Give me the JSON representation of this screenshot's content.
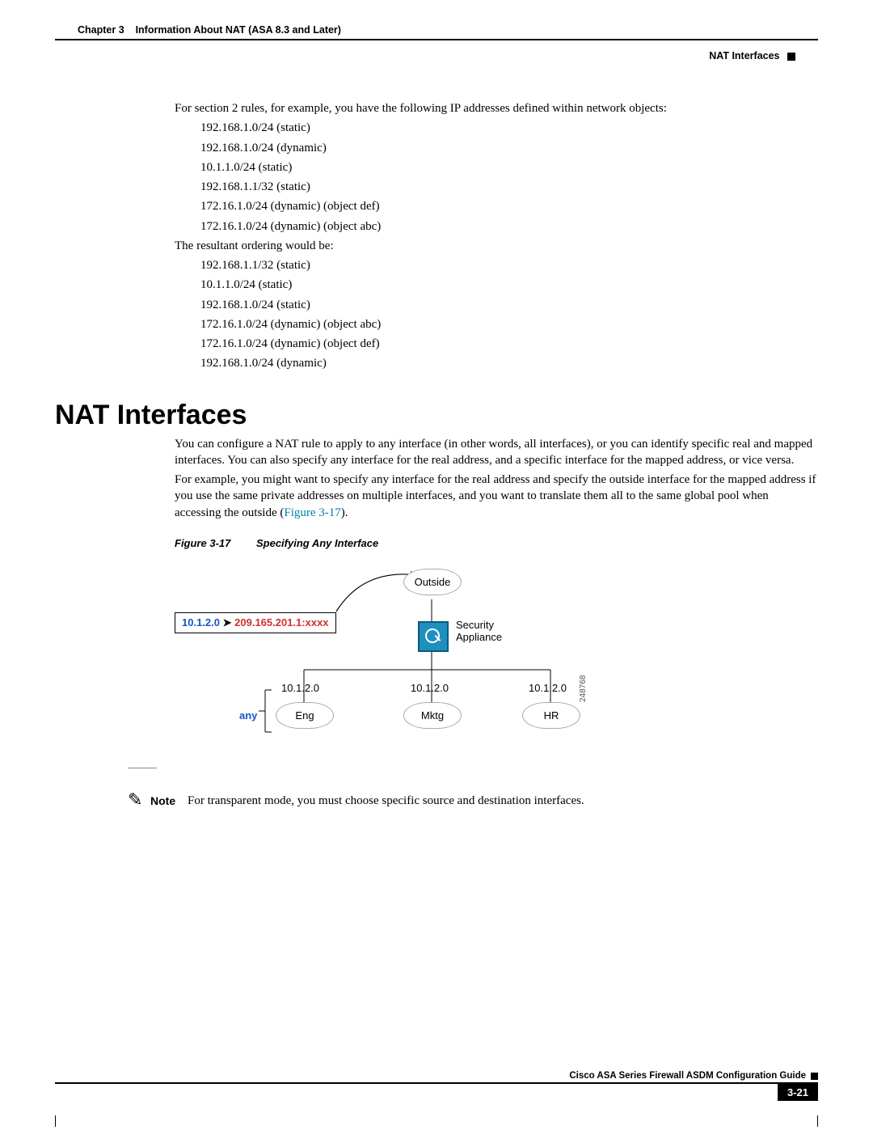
{
  "header": {
    "chapter": "Chapter 3",
    "chapter_title": "Information About NAT (ASA 8.3 and Later)",
    "section_right": "NAT Interfaces"
  },
  "body": {
    "p_intro": "For section 2 rules, for example, you have the following IP addresses defined within network objects:",
    "list1": [
      "192.168.1.0/24 (static)",
      "192.168.1.0/24 (dynamic)",
      "10.1.1.0/24 (static)",
      "192.168.1.1/32 (static)",
      "172.16.1.0/24 (dynamic) (object def)",
      "172.16.1.0/24 (dynamic) (object abc)"
    ],
    "p_result": "The resultant ordering would be:",
    "list2": [
      "192.168.1.1/32 (static)",
      "10.1.1.0/24 (static)",
      "192.168.1.0/24 (static)",
      "172.16.1.0/24 (dynamic) (object abc)",
      "172.16.1.0/24 (dynamic) (object def)",
      "192.168.1.0/24 (dynamic)"
    ],
    "h1": "NAT Interfaces",
    "p1": "You can configure a NAT rule to apply to any interface (in other words, all interfaces), or you can identify specific real and mapped interfaces. You can also specify any interface for the real address, and a specific interface for the mapped address, or vice versa.",
    "p2a": "For example, you might want to specify any interface for the real address and specify the outside interface for the mapped address if you use the same private addresses on multiple interfaces, and you want to translate them all to the same global pool when accessing the outside (",
    "p2_link": "Figure 3-17",
    "p2b": ").",
    "fig": {
      "num": "Figure 3-17",
      "title": "Specifying Any Interface",
      "nat_src": "10.1.2.0",
      "nat_dst": "209.165.201.1:xxxx",
      "cloud_top": "Outside",
      "sa_label": "Security\nAppliance",
      "ip": "10.1.2.0",
      "any": "any",
      "clouds": [
        "Eng",
        "Mktg",
        "HR"
      ],
      "id": "248768"
    },
    "note_label": "Note",
    "note_text": "For transparent mode, you must choose specific source and destination interfaces."
  },
  "footer": {
    "guide": "Cisco ASA Series Firewall ASDM Configuration Guide",
    "pagenum": "3-21"
  }
}
